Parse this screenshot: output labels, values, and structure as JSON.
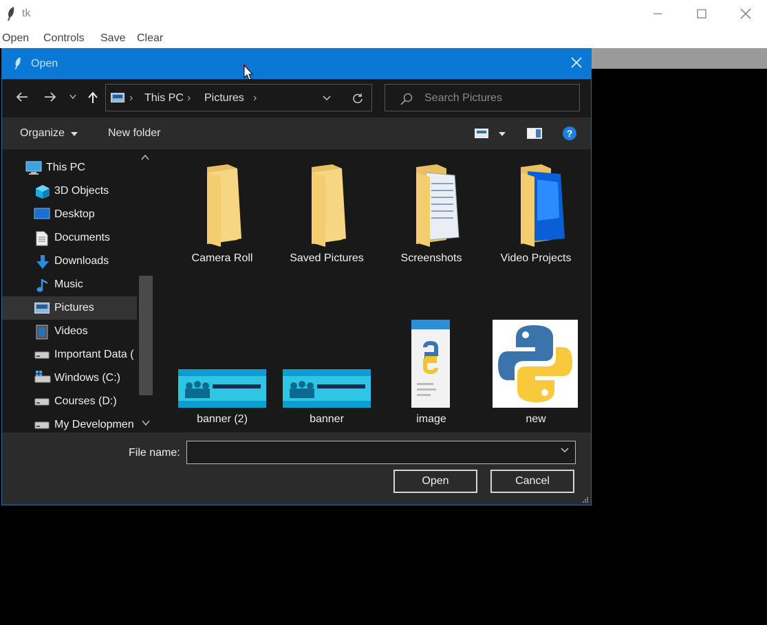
{
  "app": {
    "title": "tk"
  },
  "menu": [
    "Open",
    "Controls",
    "Save",
    "Clear"
  ],
  "dialog": {
    "title": "Open",
    "address": {
      "root": "This PC",
      "folder": "Pictures"
    },
    "search_placeholder": "Search Pictures",
    "toolbar": {
      "organize": "Organize",
      "new_folder": "New folder"
    },
    "nav": [
      {
        "label": "This PC",
        "icon": "computer-icon"
      },
      {
        "label": "3D Objects",
        "icon": "cube-icon"
      },
      {
        "label": "Desktop",
        "icon": "desktop-icon"
      },
      {
        "label": "Documents",
        "icon": "document-icon"
      },
      {
        "label": "Downloads",
        "icon": "download-icon"
      },
      {
        "label": "Music",
        "icon": "music-icon"
      },
      {
        "label": "Pictures",
        "icon": "pictures-icon",
        "selected": true
      },
      {
        "label": "Videos",
        "icon": "video-icon"
      },
      {
        "label": "Important Data (",
        "icon": "drive-icon"
      },
      {
        "label": "Windows (C:)",
        "icon": "windows-drive-icon"
      },
      {
        "label": "Courses (D:)",
        "icon": "drive-icon"
      },
      {
        "label": "My Developmen",
        "icon": "drive-icon"
      }
    ],
    "items": [
      {
        "label": "Camera Roll",
        "type": "folder"
      },
      {
        "label": "Saved Pictures",
        "type": "folder"
      },
      {
        "label": "Screenshots",
        "type": "folder-docs"
      },
      {
        "label": "Video Projects",
        "type": "folder-video"
      },
      {
        "label": "banner (2)",
        "type": "image-banner"
      },
      {
        "label": "banner",
        "type": "image-banner"
      },
      {
        "label": "image",
        "type": "image-python-tall"
      },
      {
        "label": "new",
        "type": "image-python"
      }
    ],
    "file_name_label": "File name:",
    "file_name_value": "",
    "buttons": {
      "open": "Open",
      "cancel": "Cancel"
    }
  },
  "colors": {
    "titlebar": "#0a78d4",
    "dialog_bg": "#191919",
    "panel_bg": "#2b2b2b",
    "folder": "#f3d27a"
  }
}
